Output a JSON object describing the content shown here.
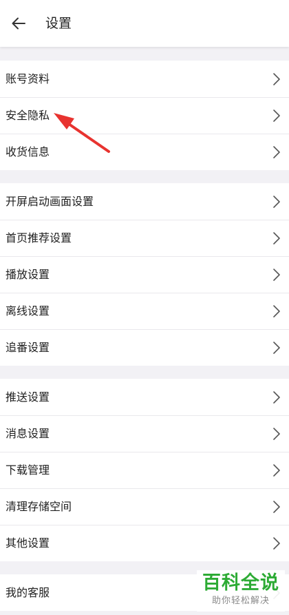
{
  "header": {
    "title": "设置",
    "back_icon": "arrow-left-icon"
  },
  "groups": [
    {
      "items": [
        {
          "label": "账号资料"
        },
        {
          "label": "安全隐私"
        },
        {
          "label": "收货信息"
        }
      ]
    },
    {
      "items": [
        {
          "label": "开屏启动画面设置"
        },
        {
          "label": "首页推荐设置"
        },
        {
          "label": "播放设置"
        },
        {
          "label": "离线设置"
        },
        {
          "label": "追番设置"
        }
      ]
    },
    {
      "items": [
        {
          "label": "推送设置"
        },
        {
          "label": "消息设置"
        },
        {
          "label": "下载管理"
        },
        {
          "label": "清理存储空间"
        },
        {
          "label": "其他设置"
        }
      ]
    },
    {
      "items": [
        {
          "label": "我的客服"
        }
      ]
    }
  ],
  "annotation": {
    "color": "#e8332f",
    "points_to": "安全隐私"
  },
  "watermark": {
    "title": "百科全说",
    "subtitle": "助你轻松解决",
    "color": "#2dab35"
  }
}
